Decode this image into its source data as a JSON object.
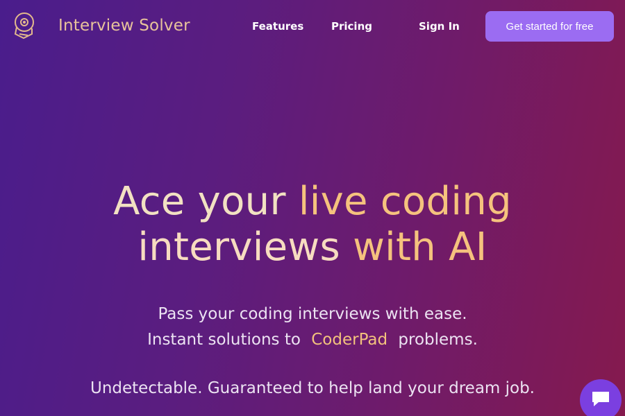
{
  "nav": {
    "brand": "Interview Solver",
    "links": [
      {
        "label": "Features"
      },
      {
        "label": "Pricing"
      },
      {
        "label": "Sign In"
      }
    ],
    "cta_label": "Get started for free",
    "logo_icon": "robot-head-icon"
  },
  "hero": {
    "title_part1": "Ace your ",
    "title_part2": "live coding",
    "title_part3": "interviews ",
    "title_part4": "with AI",
    "subtitle_line1": "Pass your coding interviews with ease.",
    "subtitle_line2_pre": "Instant solutions to",
    "subtitle_line2_highlight": "CoderPad",
    "subtitle_line2_post": "problems.",
    "tagline": "Undetectable. Guaranteed to help land your dream job."
  },
  "chat": {
    "icon": "chat-bubble-icon"
  },
  "colors": {
    "brand_text": "#e8c39b",
    "cta_bg": "#9b6cf2",
    "highlight": "#f3c27d",
    "chat_bg": "#7b3fe0"
  }
}
